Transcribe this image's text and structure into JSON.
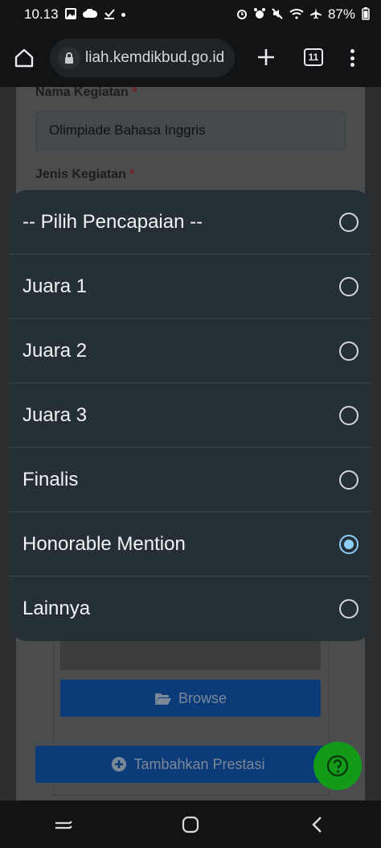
{
  "status_bar": {
    "time": "10.13",
    "battery": "87%"
  },
  "browser": {
    "url": "liah.kemdikbud.go.id",
    "tab_count": "11"
  },
  "form": {
    "nama_kegiatan_label": "Nama Kegiatan",
    "nama_kegiatan_value": "Olimpiade Bahasa Inggris",
    "jenis_kegiatan_label": "Jenis Kegiatan",
    "required_mark": "*",
    "browse_label": "Browse",
    "tambah_label": "Tambahkan Prestasi"
  },
  "dialog": {
    "options": [
      {
        "label": "-- Pilih Pencapaian --",
        "selected": false
      },
      {
        "label": "Juara 1",
        "selected": false
      },
      {
        "label": "Juara 2",
        "selected": false
      },
      {
        "label": "Juara 3",
        "selected": false
      },
      {
        "label": "Finalis",
        "selected": false
      },
      {
        "label": "Honorable Mention",
        "selected": true
      },
      {
        "label": "Lainnya",
        "selected": false
      }
    ],
    "selected_color": "#8ecdf9"
  },
  "colors": {
    "fab": "#139a18",
    "dialog_bg": "#253036"
  }
}
